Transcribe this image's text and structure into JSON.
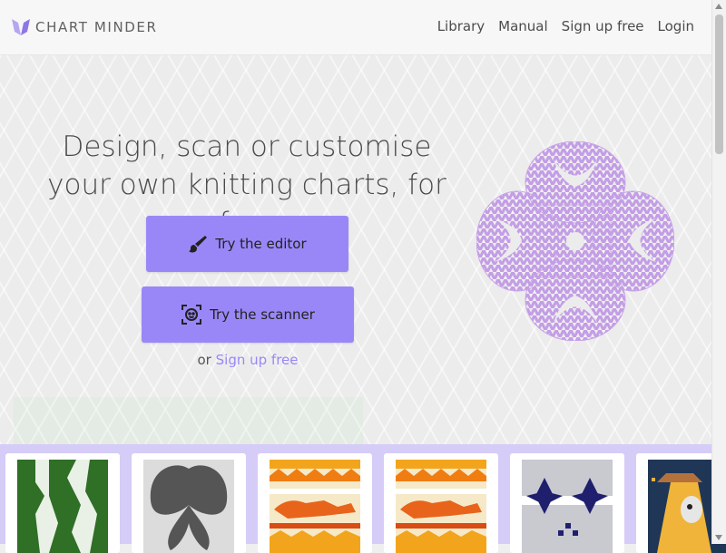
{
  "header": {
    "brand": "CHART MINDER",
    "nav": [
      "Library",
      "Manual",
      "Sign up free",
      "Login"
    ]
  },
  "hero": {
    "headline": "Design, scan or customise your own knitting charts, for free",
    "editor_button": "Try the editor",
    "scanner_button": "Try the scanner",
    "or_text": "or",
    "signup_link": "Sign up free"
  },
  "gallery": {
    "thumbnails": [
      "green-owl-chart",
      "moth-chart",
      "fox-fair-isle-chart",
      "fox-fair-isle-chart-2",
      "navy-snowflake-chart",
      "ufo-cow-chart"
    ]
  },
  "colors": {
    "accent": "#9a87f7",
    "gallery_bg": "#d5ccf7",
    "pattern_lilac": "#c9a3e8"
  }
}
